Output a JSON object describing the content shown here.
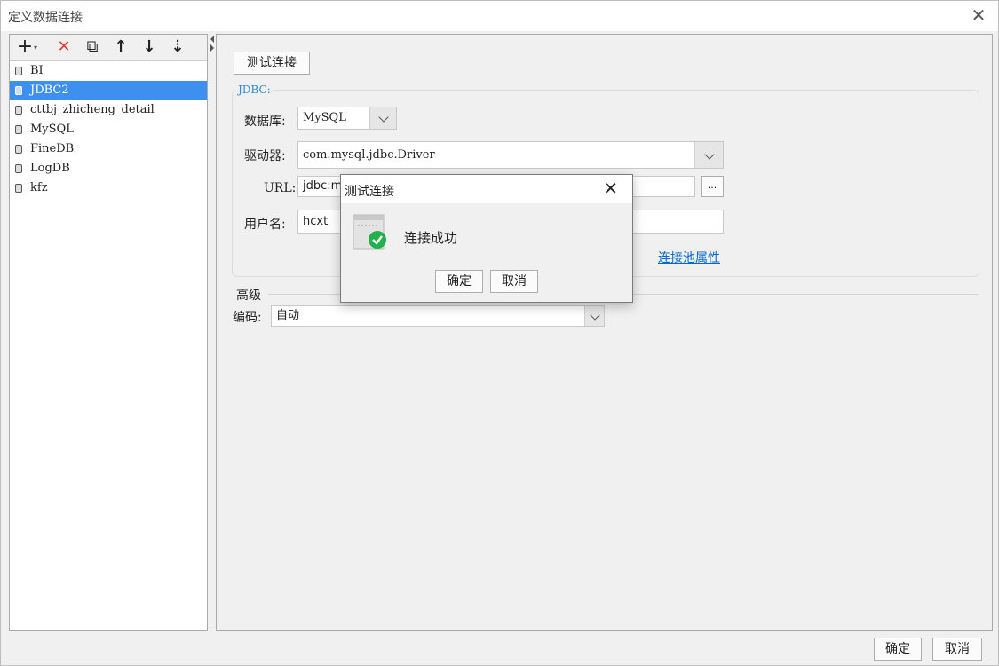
{
  "window": {
    "title": "定义数据连接",
    "close_glyph": "✕"
  },
  "toolbar": [
    {
      "name": "add-icon",
      "glyph": "+"
    },
    {
      "name": "delete-icon",
      "glyph": "✕",
      "color": "#e53935"
    },
    {
      "name": "copy-icon",
      "glyph": "⧉"
    },
    {
      "name": "move-up-icon",
      "glyph": "↑"
    },
    {
      "name": "move-down-icon",
      "glyph": "↓"
    },
    {
      "name": "sort-icon",
      "glyph": "⇣"
    }
  ],
  "connections": [
    "BI",
    "JDBC2",
    "cttbj_zhicheng_detail",
    "MySQL",
    "FineDB",
    "LogDB",
    "kfz"
  ],
  "selected_connection": "JDBC2",
  "main": {
    "test_button": "测试连接",
    "group_label": "JDBC:",
    "database_label": "数据库:",
    "database_value": "MySQL",
    "driver_label": "驱动器:",
    "driver_value": "com.mysql.jdbc.Driver",
    "url_label": "URL:",
    "url_value": "jdbc:m",
    "url_browse": "...",
    "user_label": "用户名:",
    "user_value": "hcxt",
    "pool_link": "连接池属性",
    "advanced_label": "高级",
    "encoding_label": "编码:",
    "encoding_value": "自动"
  },
  "footer": {
    "ok": "确定",
    "cancel": "取消"
  },
  "dialog": {
    "title": "测试连接",
    "close_glyph": "✕",
    "message": "连接成功",
    "ok": "确定",
    "cancel": "取消",
    "icon": "success-check-icon",
    "accent": "#22b14c"
  },
  "colors": {
    "selection": "#3d8ff0",
    "link": "#0066cc",
    "legend": "#2a8ad4"
  }
}
